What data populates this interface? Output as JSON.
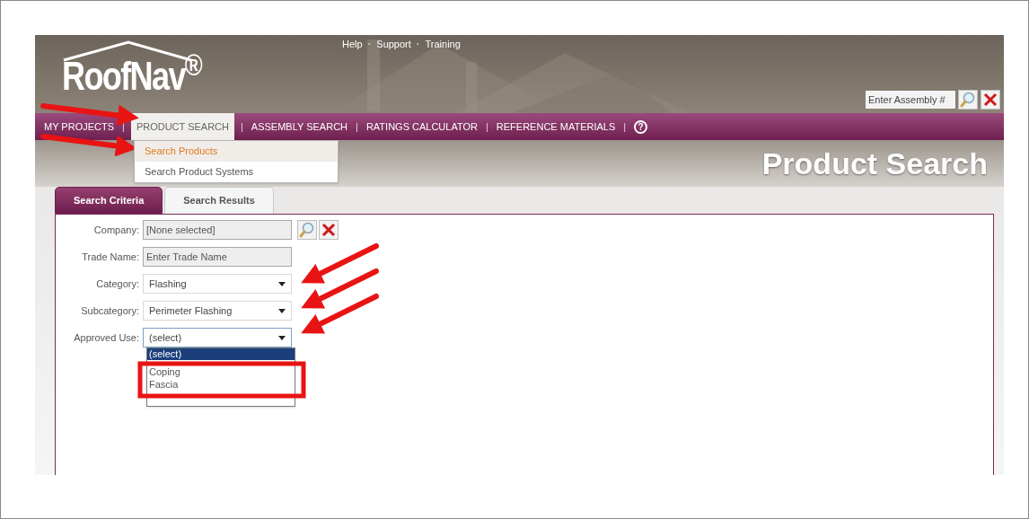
{
  "header": {
    "logo": "RoofNav$^{®}$",
    "top_links": [
      {
        "kind": "link",
        "label": "Help"
      },
      {
        "kind": "separator",
        "label": "·"
      },
      {
        "kind": "link",
        "label": "Support"
      },
      {
        "kind": "separator",
        "label": "·"
      },
      {
        "kind": "link",
        "label": "Training"
      }
    ],
    "assembly_search": {
      "placeholder": "Enter Assembly #"
    }
  },
  "nav": {
    "items": [
      {
        "kind": "link",
        "label": "MY PROJECTS",
        "selected": false
      },
      {
        "kind": "separator",
        "label": "|"
      },
      {
        "kind": "link",
        "label": "PRODUCT SEARCH",
        "selected": true
      },
      {
        "kind": "separator",
        "label": "|"
      },
      {
        "kind": "link",
        "label": "ASSEMBLY SEARCH",
        "selected": false
      },
      {
        "kind": "separator",
        "label": "|"
      },
      {
        "kind": "link",
        "label": "RATINGS CALCULATOR",
        "selected": false
      },
      {
        "kind": "separator",
        "label": "|"
      },
      {
        "kind": "link",
        "label": "REFERENCE MATERIALS",
        "selected": false
      },
      {
        "kind": "separator",
        "label": "|"
      },
      {
        "kind": "help",
        "label": "?"
      }
    ],
    "menu": [
      {
        "label": "Search Products",
        "selected": true
      },
      {
        "label": "Search Product Systems",
        "selected": false
      }
    ]
  },
  "page_title": "Product Search",
  "tabs": [
    {
      "label": "Search Criteria",
      "selected": true
    },
    {
      "label": "Search Results",
      "selected": false
    }
  ],
  "form": [
    {
      "kind": "lookup",
      "label": "Company:",
      "value": "[None selected]"
    },
    {
      "kind": "text",
      "label": "Trade Name:",
      "placeholder": "Enter Trade Name"
    },
    {
      "kind": "select",
      "label": "Category:",
      "value": "Flashing",
      "expanded": false
    },
    {
      "kind": "select",
      "label": "Subcategory:",
      "value": "Perimeter Flashing",
      "expanded": false
    },
    {
      "kind": "select",
      "label": "Approved Use:",
      "value": "(select)",
      "expanded": true,
      "options": [
        {
          "label": "(select)",
          "selected": true
        },
        {
          "label": "Coping",
          "selected": false
        },
        {
          "label": "Fascia",
          "selected": false
        }
      ]
    }
  ]
}
